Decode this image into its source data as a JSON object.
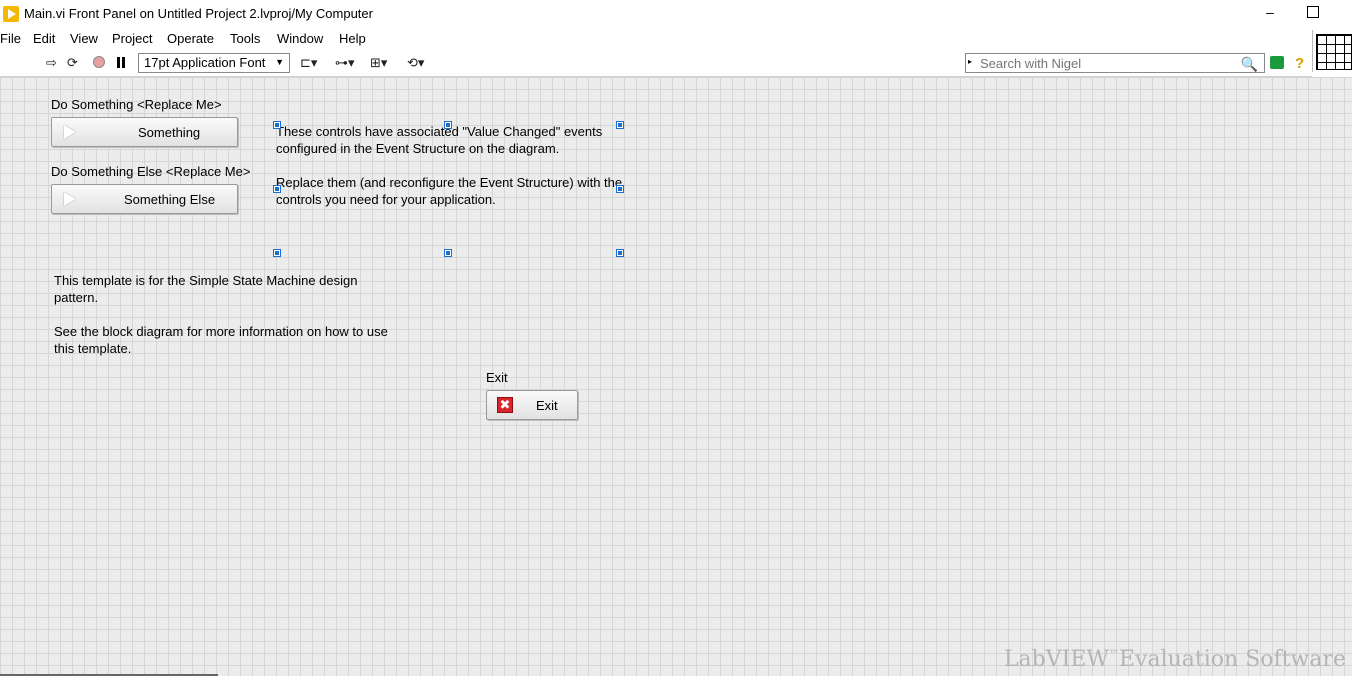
{
  "window": {
    "title": "Main.vi Front Panel on Untitled Project 2.lvproj/My Computer",
    "minimize_glyph": "–"
  },
  "menu": [
    "File",
    "Edit",
    "View",
    "Project",
    "Operate",
    "Tools",
    "Window",
    "Help"
  ],
  "toolbar": {
    "font_select_value": "17pt Application Font",
    "search_placeholder": "Search with Nigel",
    "icons": [
      "run-arrow-icon",
      "run-continuously-icon",
      "abort-icon",
      "pause-icon",
      "align-objects-icon",
      "distribute-objects-icon",
      "resize-objects-icon",
      "reorder-icon",
      "context-help-icon",
      "help-icon"
    ],
    "help_glyph": "?"
  },
  "panel": {
    "control1": {
      "label": "Do Something <Replace Me>",
      "button_text": "Something"
    },
    "control2": {
      "label": "Do Something Else <Replace Me>",
      "button_text": "Something Else"
    },
    "note_events": {
      "line1": "These controls have associated \"Value Changed\" events",
      "line2": "configured in the Event Structure on the diagram.",
      "line3": "Replace them (and reconfigure the Event Structure) with the",
      "line4": "controls you need for your application."
    },
    "note_template": {
      "line1": "This template is for the Simple State Machine design",
      "line2": "pattern.",
      "line3": "See the block diagram for more information on how to use",
      "line4": "this template."
    },
    "exit": {
      "label": "Exit",
      "button_text": "Exit",
      "icon_glyph": "✖"
    }
  },
  "watermark": {
    "brand": "LabVIEW",
    "tm": "™",
    "rest": "Evaluation Software"
  },
  "colors": {
    "panel_bg": "#ececec",
    "grid": "#d6d6d6",
    "selection_handle": "#1c6fd1",
    "exit_icon": "#d9262d"
  }
}
